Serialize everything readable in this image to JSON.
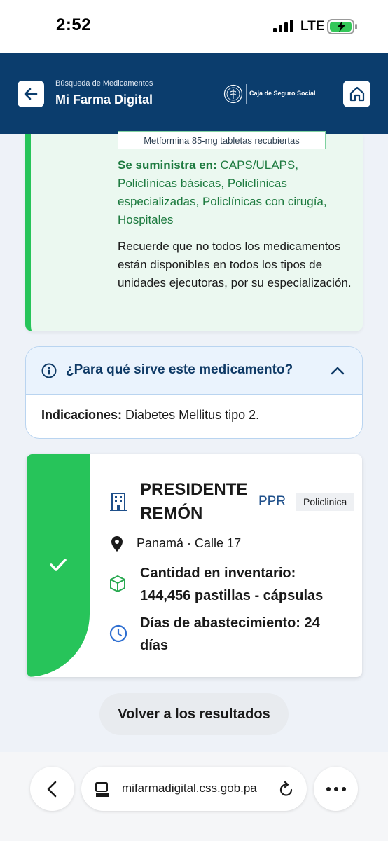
{
  "status_bar": {
    "time": "2:52",
    "network": "LTE",
    "battery_state": "charging"
  },
  "header": {
    "subtitle": "Búsqueda de Medicamentos",
    "title": "Mi Farma Digital",
    "org_name": "Caja de Seguro Social",
    "back_icon": "arrow-left-icon",
    "home_icon": "home-icon",
    "brand_color": "#0b3d6d"
  },
  "supply": {
    "product_tag": "Metformina 85-mg tabletas recubiertas",
    "label": "Se suministra en:",
    "locations": "CAPS/ULAPS, Policlínicas básicas, Policlínicas especializadas, Policlínicas con cirugía, Hospitales",
    "note": "Recuerde que no todos los medicamentos están disponibles en todos los tipos de unidades ejecutoras, por su especialización.",
    "accent_color": "#27c45a"
  },
  "purpose": {
    "title": "¿Para qué sirve este medicamento?",
    "label": "Indicaciones:",
    "text": "Diabetes Mellitus tipo 2.",
    "expanded": true
  },
  "facility": {
    "name": "PRESIDENTE REMÓN",
    "code": "PPR",
    "type": "Policlinica",
    "location": "Panamá · Calle 17",
    "quantity": "Cantidad en inventario: 144,456 pastillas - cápsulas",
    "days": "Días de abastecimiento: 24 días",
    "available": true
  },
  "actions": {
    "back_to_results": "Volver a los resultados"
  },
  "browser": {
    "url": "mifarmadigital.css.gob.pa"
  }
}
